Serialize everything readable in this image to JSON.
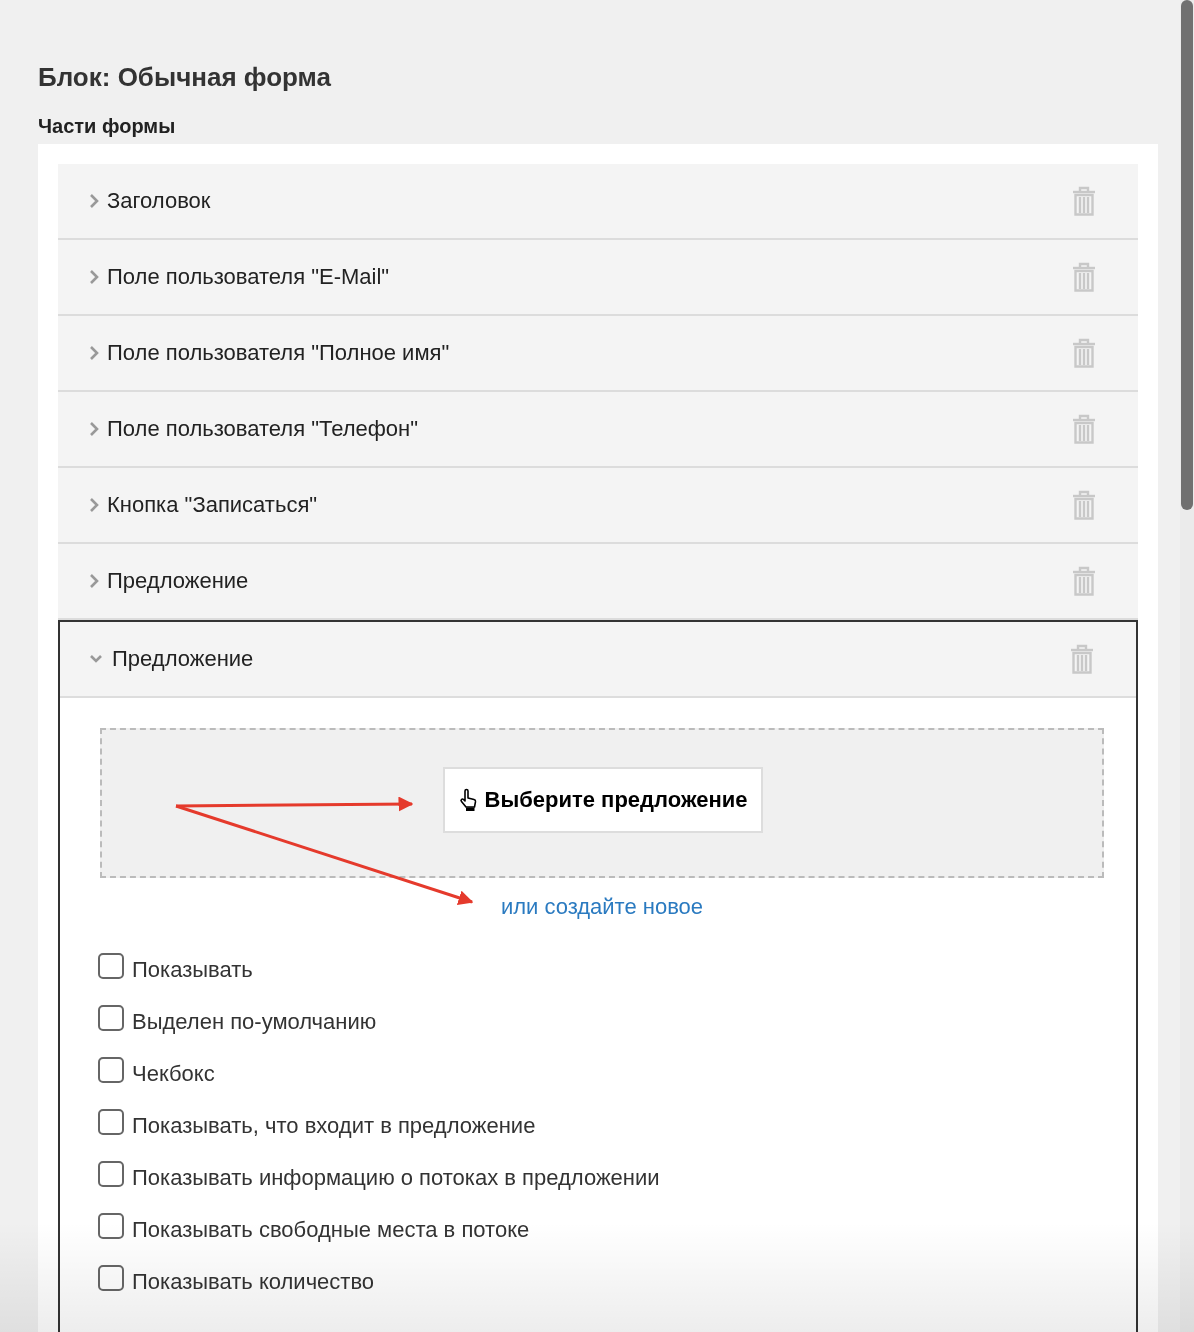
{
  "title": "Блок: Обычная форма",
  "section_title": "Части формы",
  "parts": [
    {
      "label": "Заголовок",
      "expanded": false
    },
    {
      "label": "Поле пользователя \"E-Mail\"",
      "expanded": false
    },
    {
      "label": "Поле пользователя \"Полное имя\"",
      "expanded": false
    },
    {
      "label": "Поле пользователя \"Телефон\"",
      "expanded": false
    },
    {
      "label": "Кнопка \"Записаться\"",
      "expanded": false
    },
    {
      "label": "Предложение",
      "expanded": false
    },
    {
      "label": "Предложение",
      "expanded": true
    }
  ],
  "offer": {
    "choose_button": "Выберите предложение",
    "create_link": "или создайте новое",
    "options": [
      {
        "label": "Показывать",
        "checked": false
      },
      {
        "label": "Выделен по-умолчанию",
        "checked": false
      },
      {
        "label": "Чекбокс",
        "checked": false
      },
      {
        "label": "Показывать, что входит в предложение",
        "checked": false
      },
      {
        "label": "Показывать информацию о потоках в предложении",
        "checked": false
      },
      {
        "label": "Показывать свободные места в потоке",
        "checked": false
      },
      {
        "label": "Показывать количество",
        "checked": false
      }
    ]
  }
}
